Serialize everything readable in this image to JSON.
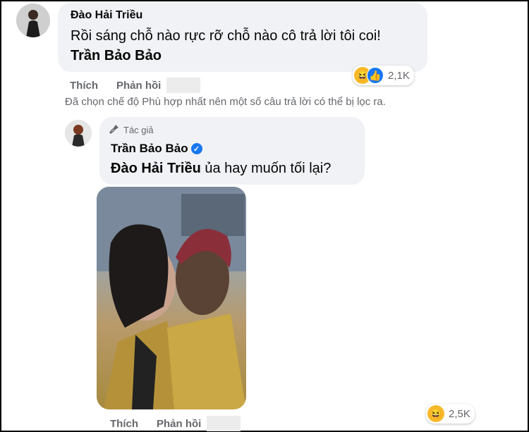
{
  "comment": {
    "author": "Đào Hải Triều",
    "text": "Rồi sáng chỗ nào rực rỡ chỗ nào cô trả lời tôi coi!",
    "mention": "Trần Bảo Bảo",
    "reaction_count": "2,1K",
    "actions": {
      "like": "Thích",
      "reply": "Phản hồi"
    }
  },
  "filter_notice": "Đã chọn chế độ Phù hợp nhất nên một số câu trả lời có thể bị lọc ra.",
  "reply": {
    "badge": "Tác giả",
    "author": "Trần Bảo Bảo",
    "mention": "Đào Hải Triều",
    "text": " ủa hay muốn tối lại?",
    "reaction_count": "2,5K",
    "actions": {
      "like": "Thích",
      "reply": "Phản hồi"
    }
  },
  "icons": {
    "haha": "haha-reaction-icon",
    "like": "like-reaction-icon",
    "verified": "verified-badge-icon",
    "mic": "microphone-icon"
  },
  "colors": {
    "bubble": "#f0f2f5",
    "muted": "#65676b",
    "accent": "#1877f2"
  }
}
